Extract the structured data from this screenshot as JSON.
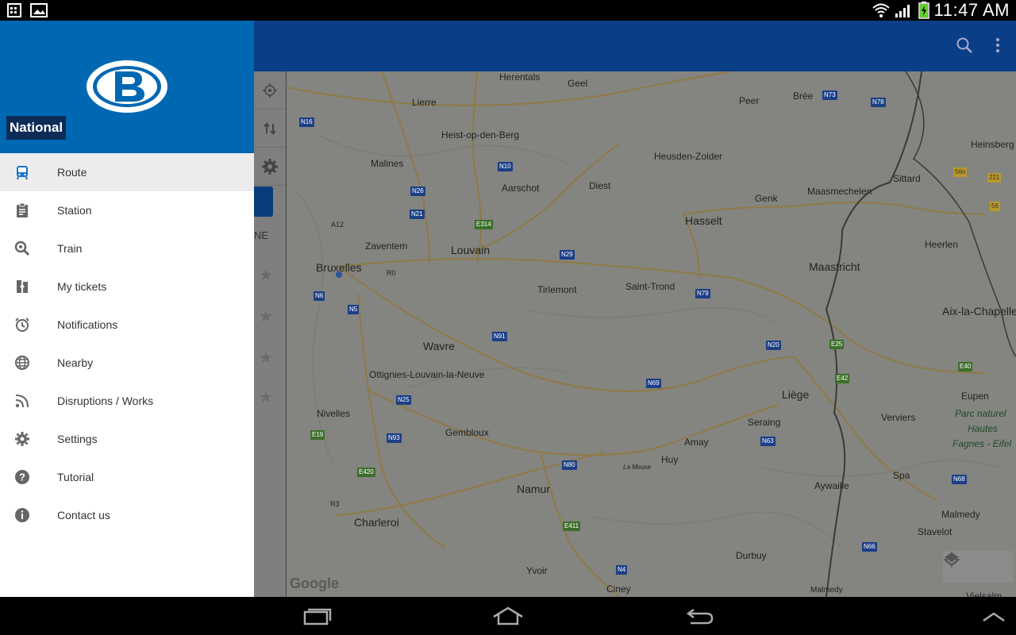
{
  "status": {
    "time": "11:47 AM"
  },
  "drawer": {
    "brand_label": "National",
    "items": [
      {
        "label": "Route",
        "icon": "train-icon"
      },
      {
        "label": "Station",
        "icon": "clipboard-icon"
      },
      {
        "label": "Train",
        "icon": "search-icon"
      },
      {
        "label": "My tickets",
        "icon": "tickets-icon"
      },
      {
        "label": "Notifications",
        "icon": "alarm-icon"
      },
      {
        "label": "Nearby",
        "icon": "globe-icon"
      },
      {
        "label": "Disruptions / Works",
        "icon": "rss-icon"
      },
      {
        "label": "Settings",
        "icon": "gear-icon"
      },
      {
        "label": "Tutorial",
        "icon": "help-icon"
      },
      {
        "label": "Contact us",
        "icon": "info-icon"
      }
    ]
  },
  "side": {
    "partial_label": "NE"
  },
  "map": {
    "attribution": "Google",
    "cities": [
      "Herentals",
      "Geel",
      "Lierre",
      "Peer",
      "Brée",
      "Heist-op-den-Berg",
      "Heinsberg",
      "Malines",
      "Heusden-Zolder",
      "Aarschot",
      "Diest",
      "Sittard",
      "Genk",
      "Maasmechelen",
      "Hasselt",
      "Zaventem",
      "Louvain",
      "Heerlen",
      "Bruxelles",
      "Maastricht",
      "Tirlemont",
      "Saint-Trond",
      "Aix-la-Chapelle",
      "Wavre",
      "Ottignies-Louvain-la-Neuve",
      "Liège",
      "Eupen",
      "Nivelles",
      "Verviers",
      "Seraing",
      "Parc naturel",
      "Hautes",
      "Fagnes - Eifel",
      "Gembloux",
      "Amay",
      "Huy",
      "Namur",
      "Spa",
      "Aywaille",
      "Charleroi",
      "Malmedy",
      "Stavelot",
      "Durbuy",
      "Yvoir",
      "Ciney",
      "Vielsalm",
      "Malmedy",
      "A12",
      "R0",
      "R3",
      "La Meuse"
    ],
    "shields": [
      "N16",
      "N73",
      "N78",
      "N10",
      "N26",
      "N21",
      "E314",
      "N29",
      "N6",
      "N5",
      "N79",
      "N91",
      "N20",
      "E25",
      "E42",
      "E40",
      "N69",
      "N25",
      "E19",
      "N93",
      "N63",
      "N80",
      "E420",
      "N68",
      "E411",
      "N66",
      "N4",
      "56n",
      "221",
      "56"
    ]
  }
}
